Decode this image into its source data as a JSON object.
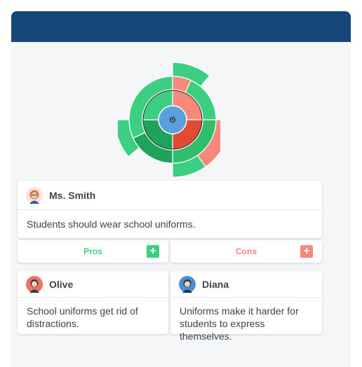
{
  "colors": {
    "header": "#16467a",
    "pro_green": "#3ccf82",
    "pro_dark_green": "#1fa35b",
    "con_red": "#f7897a",
    "con_dark_red": "#e34a33",
    "center_blue": "#5aa0dd"
  },
  "debate": {
    "thesis": {
      "author": "Ms. Smith",
      "avatar_icon": "teacher-avatar-icon",
      "text": "Students should wear school uniforms."
    },
    "pros": {
      "label": "Pros",
      "add_icon": "plus-icon",
      "arguments": [
        {
          "author": "Olive",
          "avatar_icon": "student-avatar-icon",
          "text": "School uniforms get rid of distractions."
        }
      ]
    },
    "cons": {
      "label": "Cons",
      "add_icon": "plus-icon",
      "arguments": [
        {
          "author": "Diana",
          "avatar_icon": "student-avatar-icon",
          "text": "Uniforms make it harder for students to express themselves."
        }
      ]
    }
  }
}
